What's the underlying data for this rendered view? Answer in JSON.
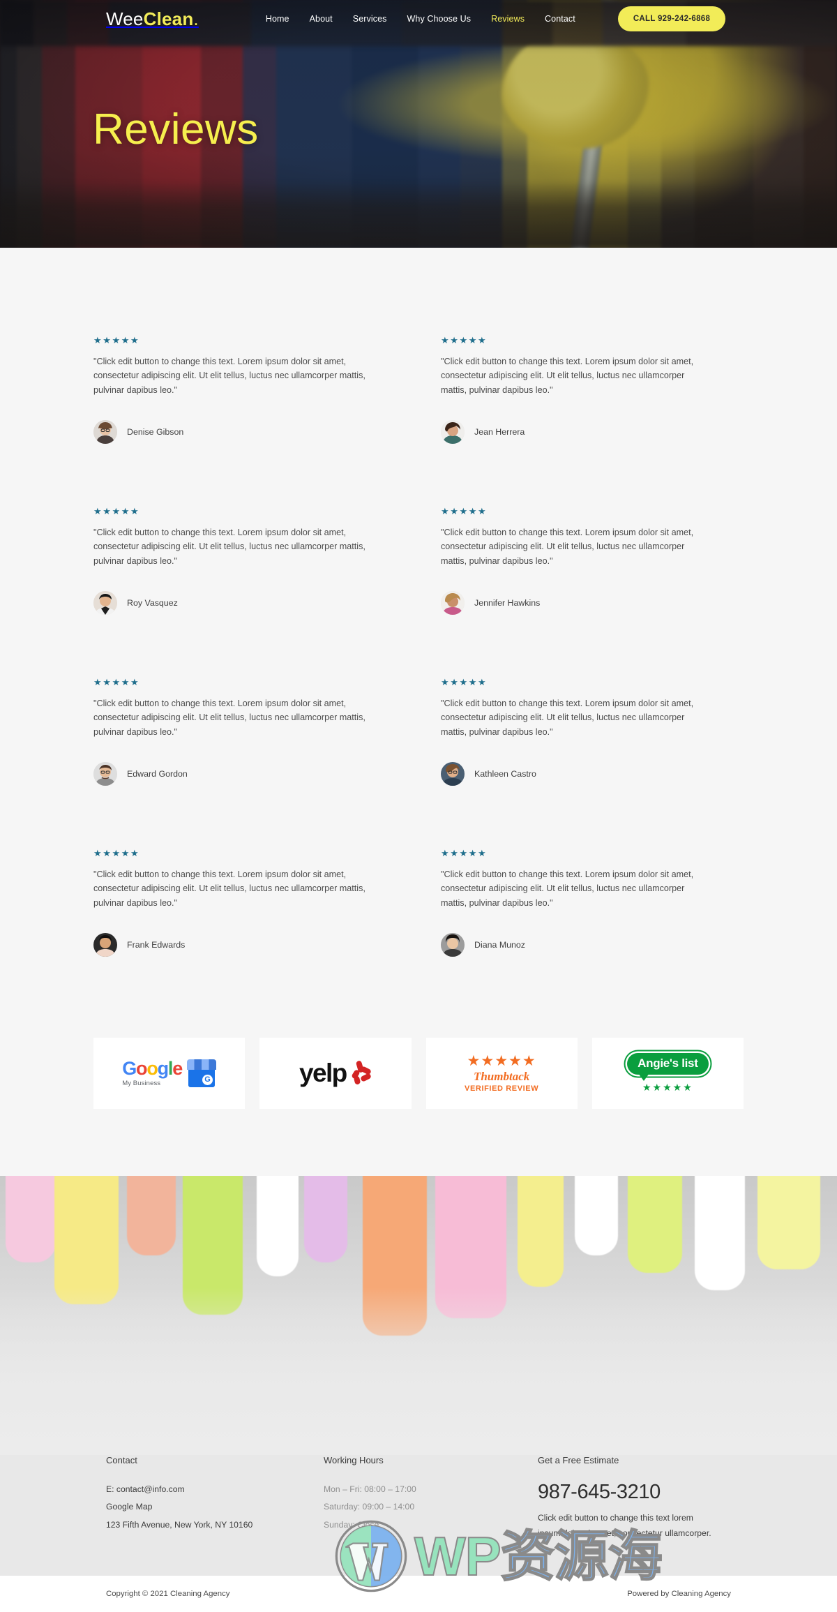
{
  "site": {
    "logo_primary": "Wee",
    "logo_accent": "Clean",
    "logo_dot": "."
  },
  "nav": {
    "items": [
      {
        "label": "Home",
        "active": false
      },
      {
        "label": "About",
        "active": false
      },
      {
        "label": "Services",
        "active": false
      },
      {
        "label": "Why Choose Us",
        "active": false
      },
      {
        "label": "Reviews",
        "active": true
      },
      {
        "label": "Contact",
        "active": false
      }
    ],
    "cta_label": "CALL 929-242-6868",
    "cta_color": "#f2ec58"
  },
  "hero": {
    "title": "Reviews"
  },
  "reviews": {
    "star_color": "#1f6e8c",
    "stars_glyph": "★★★★★",
    "body_text": "\"Click edit button to change this text. Lorem ipsum dolor sit amet, consectetur adipiscing elit. Ut elit tellus, luctus nec ullamcorper mattis, pulvinar dapibus leo.\"",
    "items": [
      {
        "name": "Denise Gibson",
        "rating": 5,
        "text": "\"Click edit button to change this text. Lorem ipsum dolor sit amet, consectetur adipiscing elit. Ut elit tellus, luctus nec ullamcorper mattis, pulvinar dapibus leo.\""
      },
      {
        "name": "Jean Herrera",
        "rating": 5,
        "text": "\"Click edit button to change this text. Lorem ipsum dolor sit amet, consectetur adipiscing elit. Ut elit tellus, luctus nec ullamcorper mattis, pulvinar dapibus leo.\""
      },
      {
        "name": "Roy Vasquez",
        "rating": 5,
        "text": "\"Click edit button to change this text. Lorem ipsum dolor sit amet, consectetur adipiscing elit. Ut elit tellus, luctus nec ullamcorper mattis, pulvinar dapibus leo.\""
      },
      {
        "name": "Jennifer Hawkins",
        "rating": 5,
        "text": "\"Click edit button to change this text. Lorem ipsum dolor sit amet, consectetur adipiscing elit. Ut elit tellus, luctus nec ullamcorper mattis, pulvinar dapibus leo.\""
      },
      {
        "name": "Edward Gordon",
        "rating": 5,
        "text": "\"Click edit button to change this text. Lorem ipsum dolor sit amet, consectetur adipiscing elit. Ut elit tellus, luctus nec ullamcorper mattis, pulvinar dapibus leo.\""
      },
      {
        "name": "Kathleen Castro",
        "rating": 5,
        "text": "\"Click edit button to change this text. Lorem ipsum dolor sit amet, consectetur adipiscing elit. Ut elit tellus, luctus nec ullamcorper mattis, pulvinar dapibus leo.\""
      },
      {
        "name": "Frank Edwards",
        "rating": 5,
        "text": "\"Click edit button to change this text. Lorem ipsum dolor sit amet, consectetur adipiscing elit. Ut elit tellus, luctus nec ullamcorper mattis, pulvinar dapibus leo.\""
      },
      {
        "name": "Diana Munoz",
        "rating": 5,
        "text": "\"Click edit button to change this text. Lorem ipsum dolor sit amet, consectetur adipiscing elit. Ut elit tellus, luctus nec ullamcorper mattis, pulvinar dapibus leo.\""
      }
    ]
  },
  "badges": [
    {
      "id": "google-my-business",
      "word": "Google",
      "sub": "My Business",
      "mark": "G"
    },
    {
      "id": "yelp",
      "word": "yelp"
    },
    {
      "id": "thumbtack",
      "stars": "★★★★★",
      "name": "Thumbtack",
      "sub": "VERIFIED REVIEW",
      "color": "#f26c21"
    },
    {
      "id": "angies-list",
      "name": "Angie's list",
      "stars": "★★★★★",
      "color": "#0a9e3e"
    }
  ],
  "footer": {
    "contact": {
      "title": "Contact",
      "email": "E: contact@info.com",
      "map_label": "Google Map",
      "address": "123 Fifth Avenue, New York, NY 10160"
    },
    "hours": {
      "title": "Working Hours",
      "lines": [
        "Mon – Fri: 08:00 – 17:00",
        "Saturday: 09:00 – 14:00",
        "Sunday: Close"
      ]
    },
    "estimate": {
      "title": "Get a Free Estimate",
      "phone": "987-645-3210",
      "text": "Click edit button to change this text lorem ipsum dolor sit amet, consectetur ullamcorper."
    },
    "bar": {
      "copyright": "Copyright © 2021 Cleaning Agency",
      "powered": "Powered by Cleaning Agency"
    }
  },
  "watermark": {
    "wp": "WP",
    "cn": "资源海"
  }
}
